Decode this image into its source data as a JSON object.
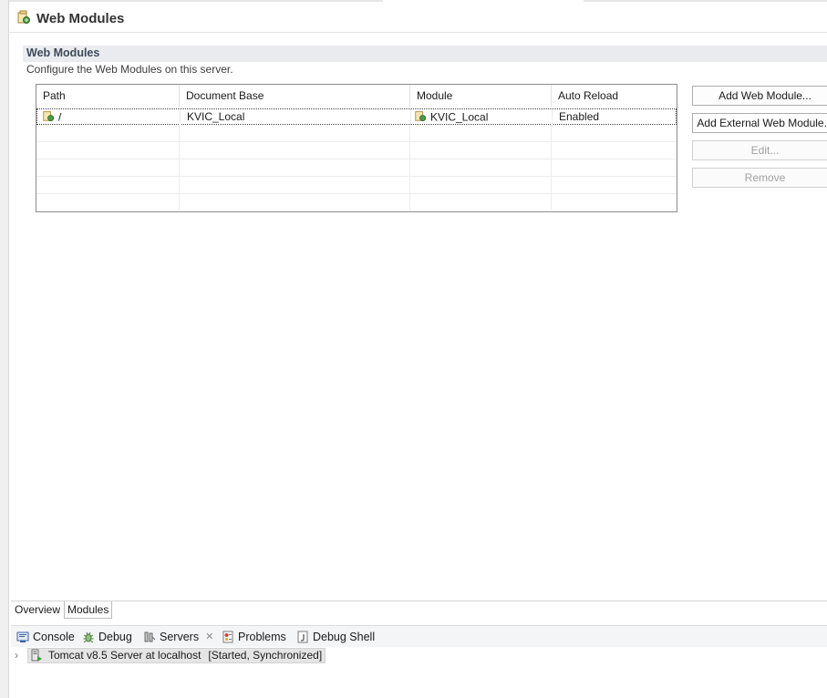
{
  "editor": {
    "title": "Web Modules"
  },
  "section": {
    "title": "Web Modules",
    "description": "Configure the Web Modules on this server."
  },
  "table": {
    "columns": [
      "Path",
      "Document Base",
      "Module",
      "Auto Reload"
    ],
    "rows": [
      {
        "path": "/",
        "document_base": "KVIC_Local",
        "module": "KVIC_Local",
        "auto_reload": "Enabled"
      }
    ]
  },
  "buttons": {
    "add_web_module": "Add Web Module...",
    "add_external_web_module": "Add External Web Module...",
    "edit": "Edit...",
    "remove": "Remove"
  },
  "editor_tabs": [
    "Overview",
    "Modules"
  ],
  "views": {
    "console": "Console",
    "debug": "Debug",
    "servers": "Servers",
    "problems": "Problems",
    "debug_shell": "Debug Shell"
  },
  "server": {
    "name": "Tomcat v8.5 Server at localhost",
    "status": "[Started, Synchronized]"
  },
  "colors": {
    "section_bar": "#e9ebef",
    "section_title": "#3d4a5a",
    "disabled_text": "#a0a0a0"
  }
}
